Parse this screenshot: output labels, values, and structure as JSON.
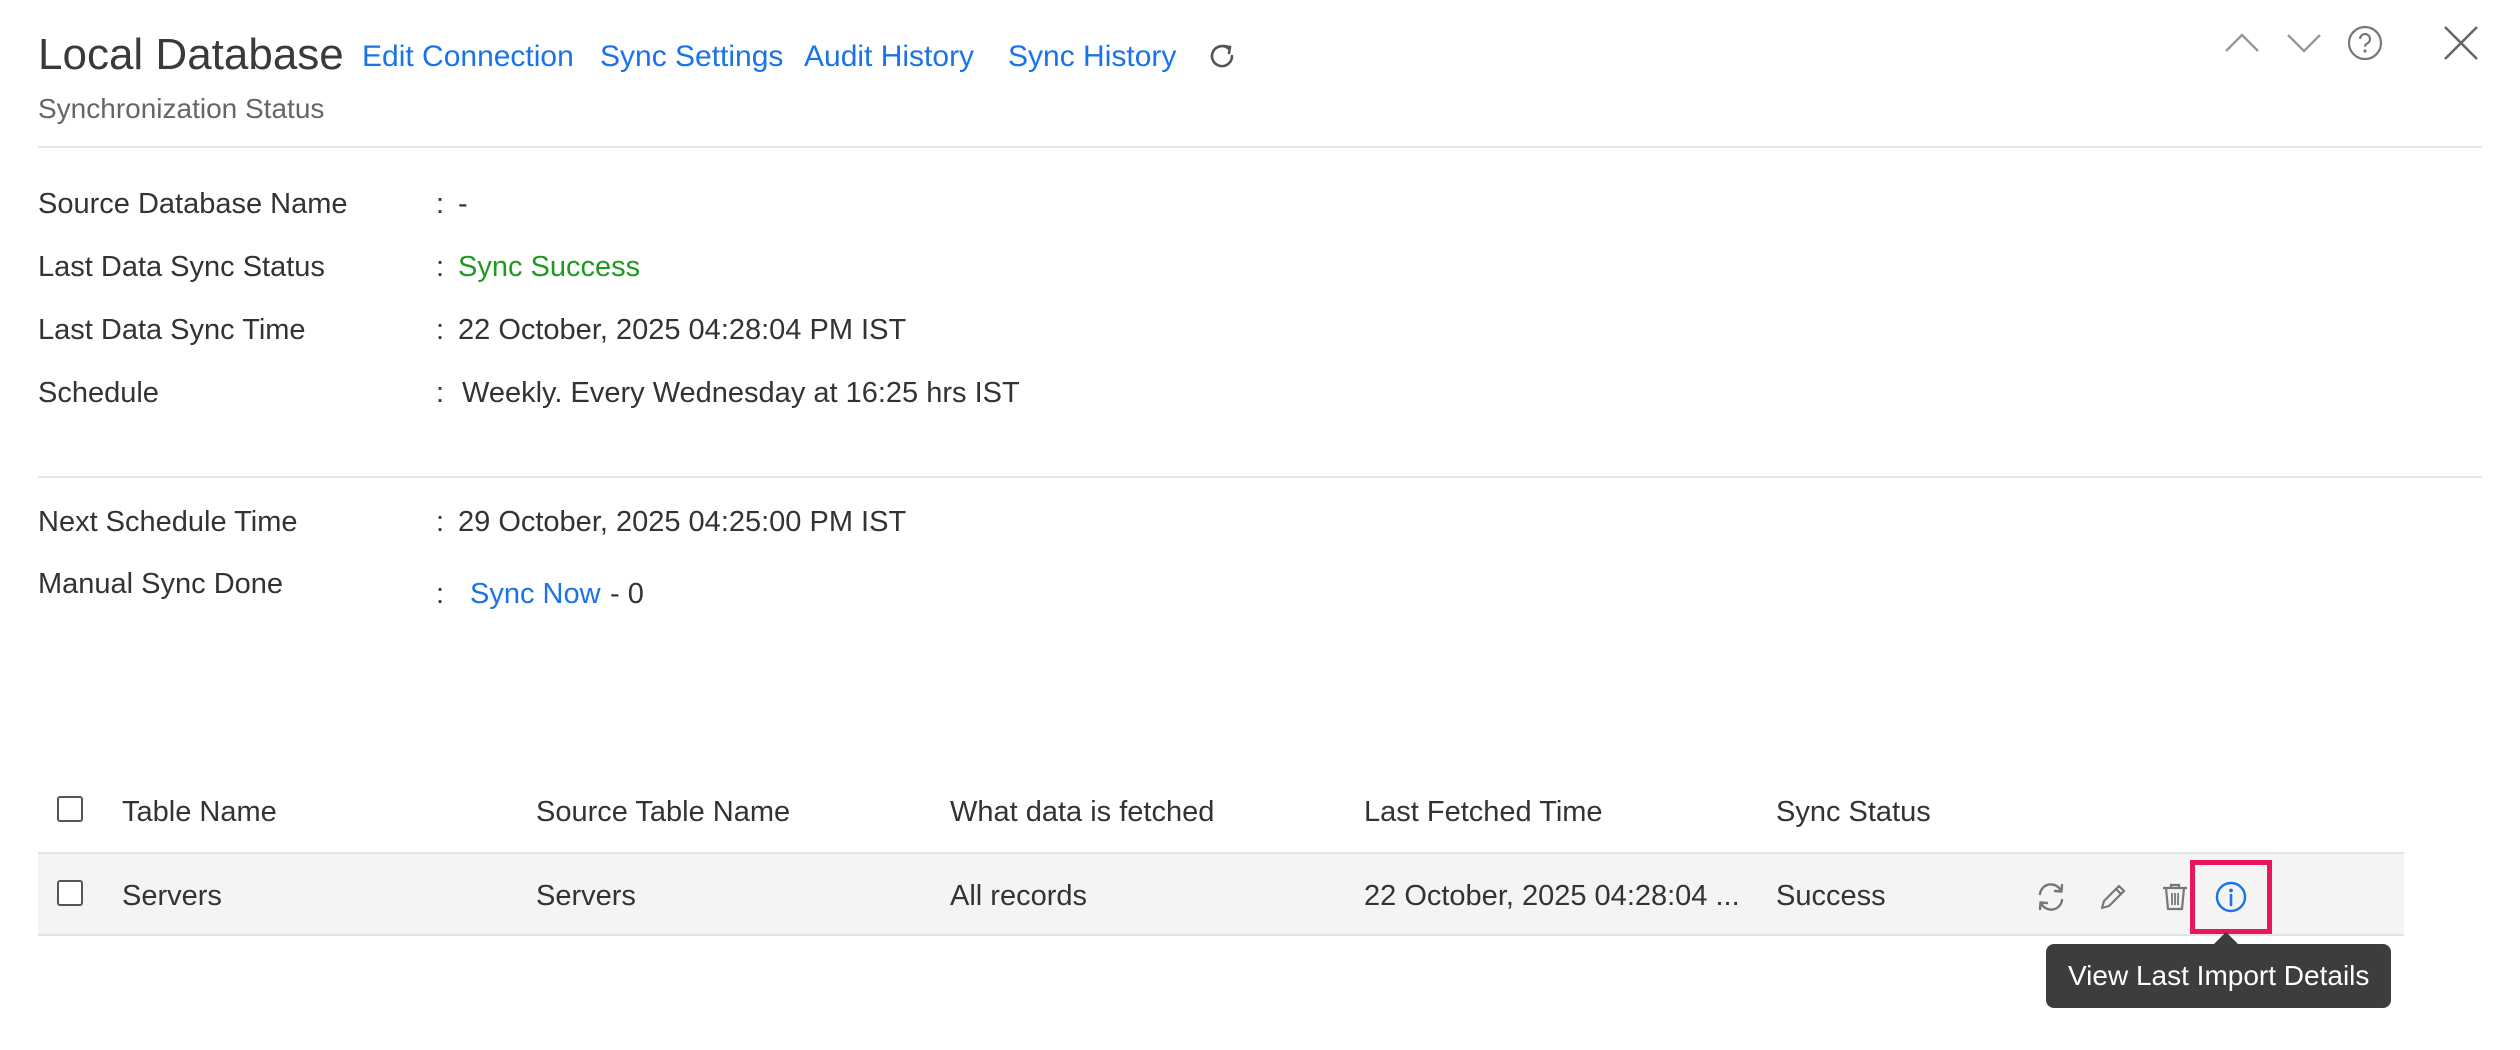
{
  "header": {
    "title": "Local Database",
    "subtitle": "Synchronization Status",
    "links": {
      "edit_connection": "Edit Connection",
      "sync_settings": "Sync Settings",
      "audit_history": "Audit History",
      "sync_history": "Sync History"
    },
    "icons": [
      "refresh-icon",
      "chevron-up-icon",
      "chevron-down-icon",
      "help-icon",
      "close-icon"
    ]
  },
  "details": {
    "colon": ":",
    "source_db_label": "Source Database Name",
    "source_db_value": "-",
    "last_status_label": "Last Data Sync Status",
    "last_status_value": "Sync Success",
    "last_time_label": "Last Data Sync Time",
    "last_time_value": "22 October, 2025 04:28:04 PM IST",
    "schedule_label": "Schedule",
    "schedule_value": "Weekly. Every Wednesday at 16:25 hrs IST",
    "next_schedule_label": "Next Schedule Time",
    "next_schedule_value": "29 October, 2025 04:25:00 PM IST",
    "manual_sync_label": "Manual Sync Done",
    "sync_now_label": "Sync Now",
    "manual_sync_count": "- 0"
  },
  "table": {
    "headers": [
      "Table Name",
      "Source Table Name",
      "What data is fetched",
      "Last Fetched Time",
      "Sync Status"
    ],
    "rows": [
      {
        "table_name": "Servers",
        "source_table_name": "Servers",
        "data_fetched": "All records",
        "last_fetched_time": "22 October, 2025 04:28:04 ...",
        "sync_status": "Success"
      }
    ],
    "row_action_icons": [
      "sync-icon",
      "edit-icon",
      "delete-icon",
      "info-icon"
    ]
  },
  "tooltip": {
    "text": "View Last Import Details"
  },
  "colors": {
    "link": "#1a73e8",
    "success": "#1e9b1e",
    "highlight": "#e8175d",
    "tooltip_bg": "#3d3d3d"
  }
}
